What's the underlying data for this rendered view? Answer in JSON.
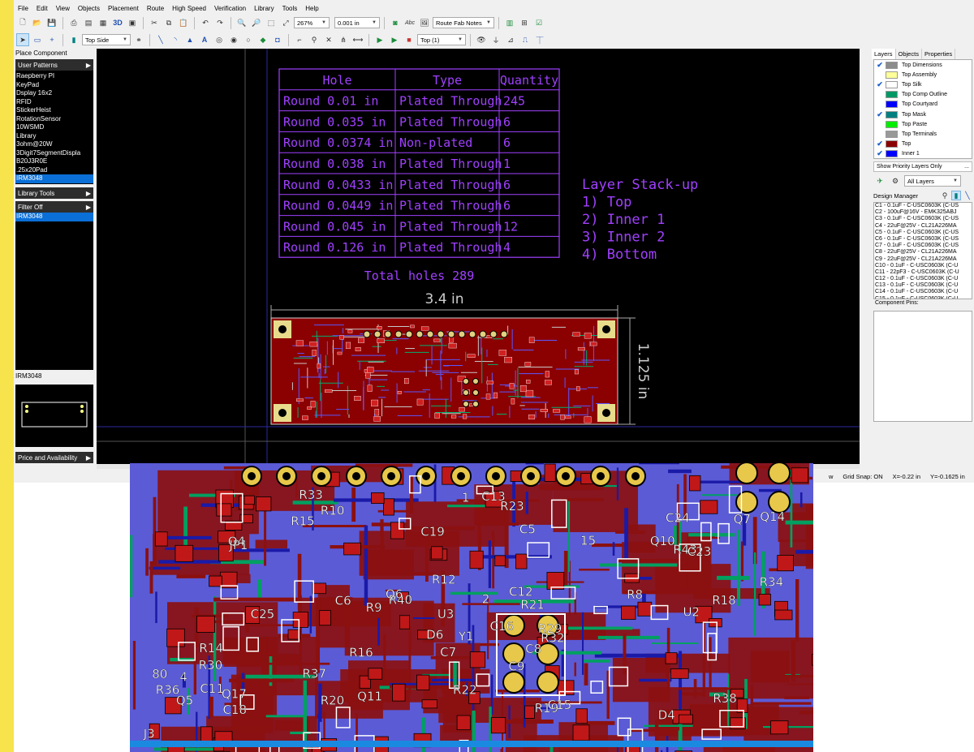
{
  "menu": [
    "File",
    "Edit",
    "View",
    "Objects",
    "Placement",
    "Route",
    "High Speed",
    "Verification",
    "Library",
    "Tools",
    "Help"
  ],
  "toolbar": {
    "zoom_value": "267%",
    "grid_value": "0.001 in",
    "route_notes": "Route Fab Notes",
    "side_value": "Top Side",
    "layer_value": "Top (1)",
    "view3d_label": "3D",
    "abc_label": "Abc"
  },
  "left": {
    "place_component": "Place Component",
    "user_patterns": "User Patterns",
    "patterns": [
      "Raepberry PI",
      "KeyPad",
      "Dsplay 16x2",
      "RFID",
      "StickerHeist",
      "RotationSensor",
      "10WSMD",
      "Library",
      "3ohm@20W",
      "3Digit7SegmentDispla",
      "B20J3R0E",
      ".25x20Pad",
      "IRM3048"
    ],
    "library_tools": "Library Tools",
    "filter_off": "Filter Off",
    "filter_item": "IRM3048",
    "preview_label": "IRM3048",
    "price": "Price and Availability"
  },
  "drill_table": {
    "headers": [
      "Hole",
      "Type",
      "Quantity"
    ],
    "rows": [
      [
        "Round 0.01 in",
        "Plated Through",
        "245"
      ],
      [
        "Round 0.035 in",
        "Plated Through",
        "6"
      ],
      [
        "Round 0.0374 in",
        "Non-plated",
        "6"
      ],
      [
        "Round 0.038 in",
        "Plated Through",
        "1"
      ],
      [
        "Round 0.0433 in",
        "Plated Through",
        "6"
      ],
      [
        "Round 0.0449 in",
        "Plated Through",
        "6"
      ],
      [
        "Round 0.045 in",
        "Plated Through",
        "12"
      ],
      [
        "Round 0.126 in",
        "Plated Through",
        "4"
      ]
    ],
    "total": "Total holes 289"
  },
  "stackup": [
    "Layer Stack-up",
    "1) Top",
    "2) Inner 1",
    "3) Inner 2",
    "4) Bottom"
  ],
  "dims": {
    "width": "3.4 in",
    "height": "1.125 in"
  },
  "right": {
    "tabs": [
      "Layers",
      "Objects",
      "Properties"
    ],
    "layers": [
      {
        "name": "Top Dimensions",
        "checked": true,
        "color": "#8c8c8c"
      },
      {
        "name": "Top Assembly",
        "checked": false,
        "color": "#ffff99"
      },
      {
        "name": "Top Silk",
        "checked": true,
        "color": "#ffffff"
      },
      {
        "name": "Top Comp Outline",
        "checked": false,
        "color": "#009966"
      },
      {
        "name": "Top Courtyard",
        "checked": false,
        "color": "#0000ff"
      },
      {
        "name": "Top Mask",
        "checked": true,
        "color": "#008080"
      },
      {
        "name": "Top Paste",
        "checked": false,
        "color": "#00ee00"
      },
      {
        "name": "Top Terminals",
        "checked": false,
        "color": "#999999"
      },
      {
        "name": "Top",
        "checked": true,
        "color": "#8b0000"
      },
      {
        "name": "Inner 1",
        "checked": true,
        "color": "#0000ff"
      }
    ],
    "show_priority": "Show Priority Layers Only",
    "more": "...",
    "all_layers": "All Layers",
    "design_manager": "Design Manager",
    "components": [
      "C1 - 0.1uF - C-USC0603K (C-US",
      "C2 - 100uF@16V - EMK325ABJ",
      "C3 - 0.1uF - C-USC0603K (C-US",
      "C4 - 22uF@25V - CL21A226MA",
      "C5 - 0.1uF - C-USC0603K (C-US",
      "C6 - 0.1uF - C-USC0603K (C-US",
      "C7 - 0.1uF - C-USC0603K (C-US",
      "C8 - 22uF@25V - CL21A226MA",
      "C9 - 22uF@25V - CL21A226MA",
      "C10 - 0.1uF - C-USC0603K (C-U",
      "C11 - 22pF3 - C-USC0603K (C-U",
      "C12 - 0.1uF - C-USC0603K (C-U",
      "C13 - 0.1uF - C-USC0603K (C-U",
      "C14 - 0.1uF - C-USC0603K (C-U",
      "C15 - 0.1uF - C-USC0603K (C-U",
      "C16 - 22uF@25V - CL21A226M.",
      "C17 - 22uF@25V - CL21A226MA",
      "C18 - 0.1uF - C-USC0603K (C-U"
    ],
    "component_pins": "Component Pins:"
  },
  "status": {
    "grid_snap": "Grid Snap: ON",
    "x": "X=-0.22 in",
    "y": "Y=-0.1625 in",
    "w": "w"
  },
  "zoom_labels": [
    "R15",
    "R18",
    "R40",
    "D4",
    "R30",
    "JP1",
    "R21",
    "R20",
    "R16",
    "Q7",
    "Q10",
    "R10",
    "Q4",
    "Q14",
    "Q11",
    "R23",
    "C18",
    "R43",
    "C13",
    "R19",
    "R14",
    "Q6",
    "R8",
    "R12",
    "D6",
    "R38",
    "R37",
    "Q5",
    "R9",
    "C24",
    "C16",
    "C7",
    "R22",
    "R33",
    "C9",
    "C5",
    "Y1",
    "J3",
    "U3",
    "R32",
    "C11",
    "C19",
    "R34",
    "C25",
    "U2",
    "C23",
    "C12",
    "R36",
    "R29",
    "C15",
    "C6",
    "C8",
    "15",
    "80",
    "Q17",
    "4",
    "1",
    "2"
  ],
  "colors": {
    "purple": "#a040ff",
    "board": "#8b0000",
    "canvas": "#000000"
  }
}
